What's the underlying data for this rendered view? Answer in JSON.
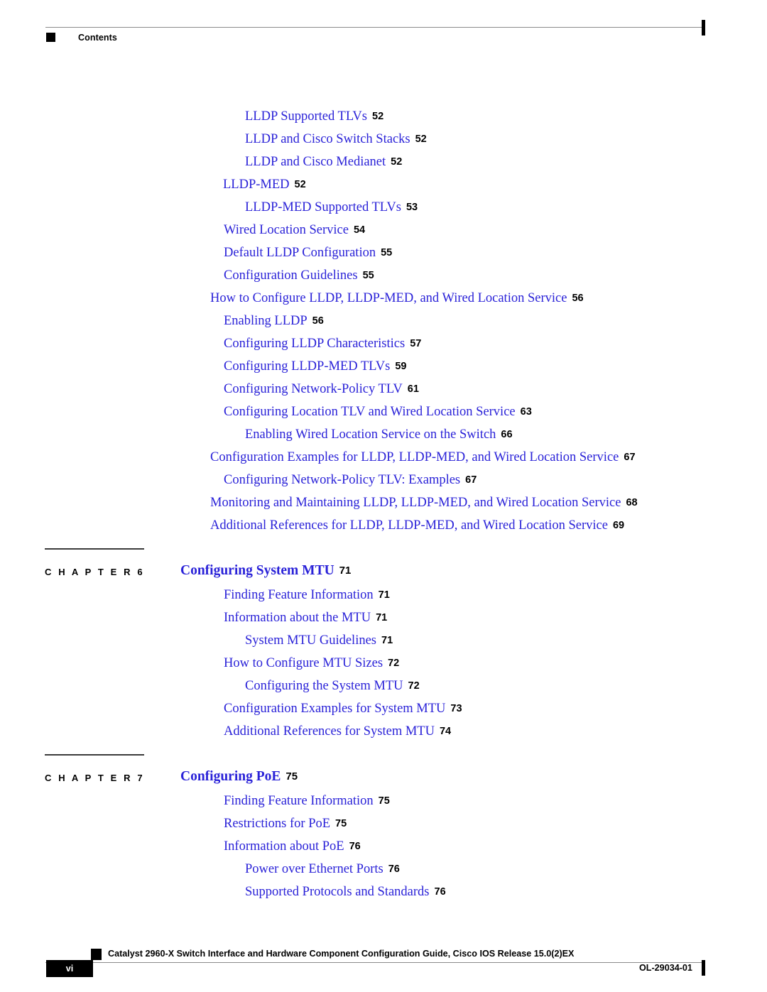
{
  "header": {
    "label": "Contents"
  },
  "toc": {
    "entries": [
      {
        "title": "LLDP Supported TLVs",
        "page": "52",
        "level": 2
      },
      {
        "title": "LLDP and Cisco Switch Stacks",
        "page": "52",
        "level": 2
      },
      {
        "title": "LLDP and Cisco Medianet",
        "page": "52",
        "level": 2
      },
      {
        "title": "LLDP-MED",
        "page": "52",
        "level": 1
      },
      {
        "title": "LLDP-MED Supported TLVs",
        "page": "53",
        "level": 2
      },
      {
        "title": "Wired Location Service",
        "page": "54",
        "level": 1
      },
      {
        "title": "Default LLDP Configuration",
        "page": "55",
        "level": 1
      },
      {
        "title": "Configuration Guidelines",
        "page": "55",
        "level": 1
      },
      {
        "title": "How to Configure LLDP, LLDP-MED, and Wired Location Service",
        "page": "56",
        "level": 0
      },
      {
        "title": "Enabling LLDP",
        "page": "56",
        "level": 1
      },
      {
        "title": "Configuring LLDP Characteristics",
        "page": "57",
        "level": 1
      },
      {
        "title": "Configuring LLDP-MED TLVs",
        "page": "59",
        "level": 1
      },
      {
        "title": "Configuring Network-Policy TLV",
        "page": "61",
        "level": 1
      },
      {
        "title": "Configuring Location TLV and Wired Location Service",
        "page": "63",
        "level": 1
      },
      {
        "title": "Enabling Wired Location Service on the Switch",
        "page": "66",
        "level": 2
      },
      {
        "title": "Configuration Examples for LLDP, LLDP-MED, and Wired Location Service",
        "page": "67",
        "level": 0
      },
      {
        "title": "Configuring Network-Policy TLV: Examples",
        "page": "67",
        "level": 1
      },
      {
        "title": "Monitoring and Maintaining LLDP, LLDP-MED, and Wired Location Service",
        "page": "68",
        "level": 0
      },
      {
        "title": "Additional References for LLDP, LLDP-MED, and Wired Location Service",
        "page": "69",
        "level": 0
      }
    ]
  },
  "chapters": [
    {
      "label": "C H A P T E R   6",
      "title": "Configuring System MTU",
      "page": "71",
      "entries": [
        {
          "title": "Finding Feature Information",
          "page": "71",
          "level": 1
        },
        {
          "title": "Information about the MTU",
          "page": "71",
          "level": 1
        },
        {
          "title": "System MTU Guidelines",
          "page": "71",
          "level": 2
        },
        {
          "title": "How to Configure MTU Sizes",
          "page": "72",
          "level": 1
        },
        {
          "title": "Configuring the System MTU",
          "page": "72",
          "level": 2
        },
        {
          "title": "Configuration Examples for System MTU",
          "page": "73",
          "level": 1
        },
        {
          "title": "Additional References for System MTU",
          "page": "74",
          "level": 1
        }
      ]
    },
    {
      "label": "C H A P T E R   7",
      "title": "Configuring PoE",
      "page": "75",
      "entries": [
        {
          "title": "Finding Feature Information",
          "page": "75",
          "level": 1
        },
        {
          "title": "Restrictions for PoE",
          "page": "75",
          "level": 1
        },
        {
          "title": "Information about PoE",
          "page": "76",
          "level": 1
        },
        {
          "title": "Power over Ethernet Ports",
          "page": "76",
          "level": 2
        },
        {
          "title": "Supported Protocols and Standards",
          "page": "76",
          "level": 3
        }
      ]
    }
  ],
  "footer": {
    "guide_title": "Catalyst 2960-X Switch Interface and Hardware Component Configuration Guide, Cisco IOS Release 15.0(2)EX",
    "page_number": "vi",
    "doc_id": "OL-29034-01"
  }
}
